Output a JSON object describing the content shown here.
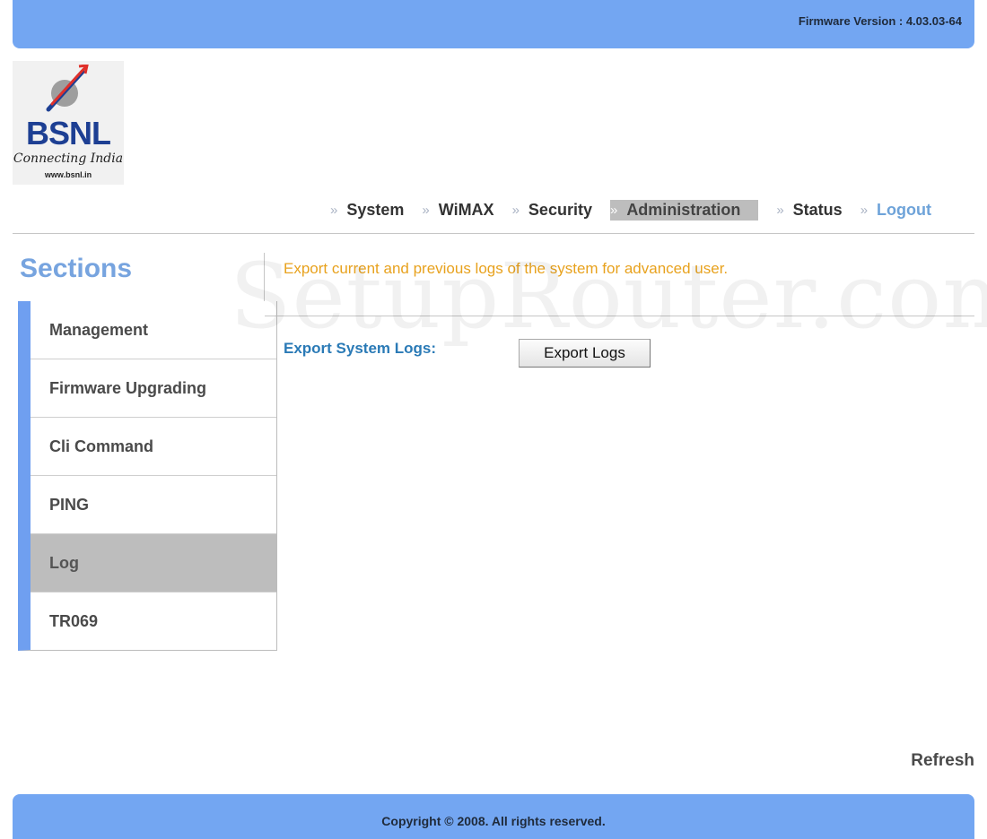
{
  "header": {
    "firmware_version": "Firmware Version : 4.03.03-64"
  },
  "logo": {
    "brand": "BSNL",
    "tagline": "Connecting India",
    "url": "www.bsnl.in"
  },
  "nav": {
    "separator": "»",
    "items": [
      {
        "label": "System"
      },
      {
        "label": "WiMAX"
      },
      {
        "label": "Security"
      },
      {
        "label": "Administration",
        "active": true
      },
      {
        "label": "Status"
      },
      {
        "label": "Logout"
      }
    ]
  },
  "sidebar": {
    "title": "Sections",
    "items": [
      {
        "label": "Management"
      },
      {
        "label": "Firmware Upgrading"
      },
      {
        "label": "Cli Command"
      },
      {
        "label": "PING"
      },
      {
        "label": "Log",
        "active": true
      },
      {
        "label": "TR069"
      }
    ]
  },
  "main": {
    "description": "Export current and previous logs of the system for advanced user.",
    "export_label": "Export System Logs:",
    "export_button": "Export Logs"
  },
  "refresh_label": "Refresh",
  "footer": {
    "copyright": "Copyright © 2008.  All rights reserved."
  },
  "watermark": "SetupRouter.com",
  "colors": {
    "bar_blue": "#73a6f2",
    "sidebar_accent": "#6f9ff0",
    "description_orange": "#e8a21e",
    "label_blue": "#2a7ab6",
    "active_gray": "#bdbdbd"
  }
}
